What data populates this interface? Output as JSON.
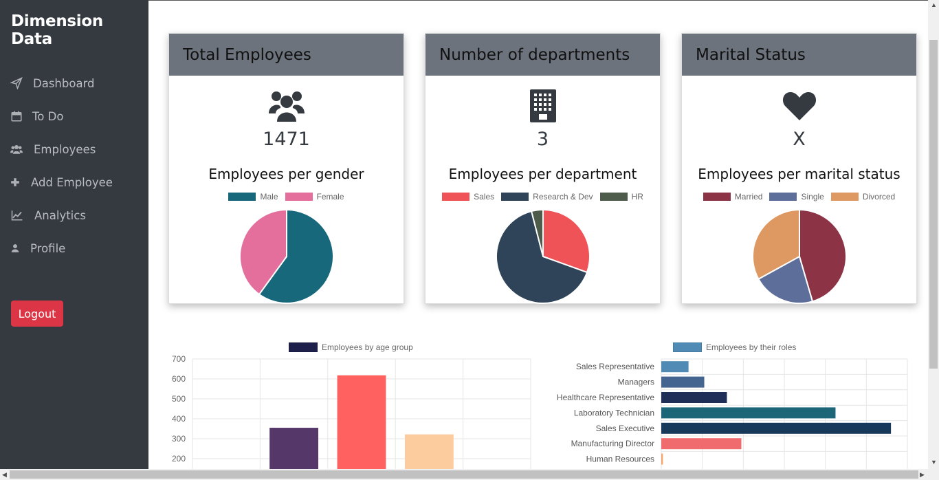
{
  "brand": "Dimension Data",
  "nav": [
    {
      "label": "Dashboard",
      "icon": "paper-plane-icon"
    },
    {
      "label": "To Do",
      "icon": "calendar-icon"
    },
    {
      "label": "Employees",
      "icon": "users-icon"
    },
    {
      "label": "Add Employee",
      "icon": "plus-icon"
    },
    {
      "label": "Analytics",
      "icon": "line-chart-icon"
    },
    {
      "label": "Profile",
      "icon": "user-icon"
    }
  ],
  "logout_label": "Logout",
  "cards": [
    {
      "title": "Total Employees",
      "icon": "users-icon",
      "value": "1471",
      "subtitle": "Employees per gender"
    },
    {
      "title": "Number of departments",
      "icon": "building-icon",
      "value": "3",
      "subtitle": "Employees per department"
    },
    {
      "title": "Marital Status",
      "icon": "heart-icon",
      "value": "X",
      "subtitle": "Employees per marital status"
    }
  ],
  "colors": {
    "sidebar": "#343a40",
    "card_header": "#6c737c",
    "logout": "#dc3545"
  },
  "chart_data": [
    {
      "type": "pie",
      "title": "Employees per gender",
      "labels": [
        "Male",
        "Female"
      ],
      "values": [
        60,
        40
      ],
      "colors": [
        "#17687a",
        "#e46f9d"
      ]
    },
    {
      "type": "pie",
      "title": "Employees per department",
      "labels": [
        "Sales",
        "Research & Dev",
        "HR"
      ],
      "values": [
        30.5,
        65.5,
        4
      ],
      "colors": [
        "#ef5358",
        "#2f4458",
        "#4e5d4b"
      ]
    },
    {
      "type": "pie",
      "title": "Employees per marital status",
      "labels": [
        "Married",
        "Single",
        "Divorced"
      ],
      "values": [
        45.5,
        21.5,
        33
      ],
      "colors": [
        "#8c3346",
        "#5c6e99",
        "#de9861"
      ]
    },
    {
      "type": "bar",
      "legend": "Employees by age group",
      "legend_color": "#1e1f4b",
      "categories": [
        "",
        "",
        "",
        "",
        ""
      ],
      "values": [
        null,
        355,
        618,
        322,
        null
      ],
      "colors": [
        "#1e1f4b",
        "#55376a",
        "#ff6161",
        "#fdcc9e",
        "#1e1f4b"
      ],
      "yticks": [
        700,
        600,
        500,
        400,
        300,
        200
      ],
      "ylim": [
        150,
        700
      ]
    },
    {
      "type": "bar",
      "orientation": "horizontal",
      "legend": "Employees by their roles",
      "legend_color": "#4f8bb5",
      "categories": [
        "Sales Representative",
        "Managers",
        "Healthcare Representative",
        "Laboratory Technician",
        "Sales Executive",
        "Manufacturing Director",
        "Human Resources"
      ],
      "values": [
        83,
        131,
        200,
        531,
        700,
        244,
        5
      ],
      "colors": [
        "#4f8bb5",
        "#44658f",
        "#1f2e56",
        "#1d6678",
        "#16395c",
        "#ef6b6e",
        "#f5a56f"
      ],
      "xlim": [
        0,
        750
      ]
    }
  ]
}
